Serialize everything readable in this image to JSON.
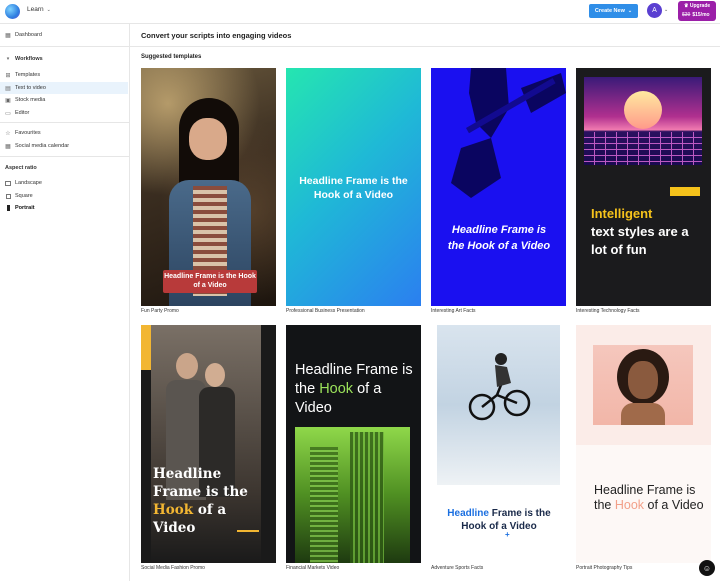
{
  "header": {
    "learn_label": "Learn",
    "create_label": "Create New",
    "avatar_initial": "A",
    "upgrade_label": "Upgrade",
    "old_price": "$30",
    "new_price": "$15/mo"
  },
  "sidebar": {
    "dashboard": "Dashboard",
    "workflows": "Workflows",
    "items": [
      "Templates",
      "Text to video",
      "Stock media",
      "Editor"
    ],
    "favourites": "Favourites",
    "calendar": "Social media calendar",
    "aspect_ratio": "Aspect ratio",
    "ratios": [
      "Landscape",
      "Square",
      "Portrait"
    ]
  },
  "main": {
    "title": "Convert your scripts into engaging videos",
    "suggested": "Suggested templates",
    "templates": [
      {
        "caption": "Fun Party Promo",
        "text": "Headline Frame is the Hook of a Video"
      },
      {
        "caption": "Professional Business Presentation",
        "text": "Headline Frame is the Hook of a Video"
      },
      {
        "caption": "Interesting Art Facts",
        "text": "Headline Frame is the Hook of a Video"
      },
      {
        "caption": "Interesting Technology Facts",
        "text_a": "Intelligent",
        "text_b": "text styles are a lot of fun"
      },
      {
        "caption": "Social Media Fashion Promo",
        "text_a": "Headline Frame is the ",
        "text_hl": "Hook",
        "text_c": " of a Video"
      },
      {
        "caption": "Financial Markets Video",
        "text_a": "Headline Frame is the ",
        "text_hl": "Hook",
        "text_c": " of a Video"
      },
      {
        "caption": "Adventure Sports Facts",
        "text_hl": "Headline",
        "text_a": " Frame is the Hook of a Video"
      },
      {
        "caption": "Portrait Photography Tips",
        "text_a": "Headline Frame is the ",
        "text_hl": "Hook",
        "text_c": " of a Video"
      }
    ]
  },
  "colors": {
    "accent": "#2f8ee8",
    "upgrade": "#9b1fa8",
    "avatar": "#5a3fd1"
  }
}
